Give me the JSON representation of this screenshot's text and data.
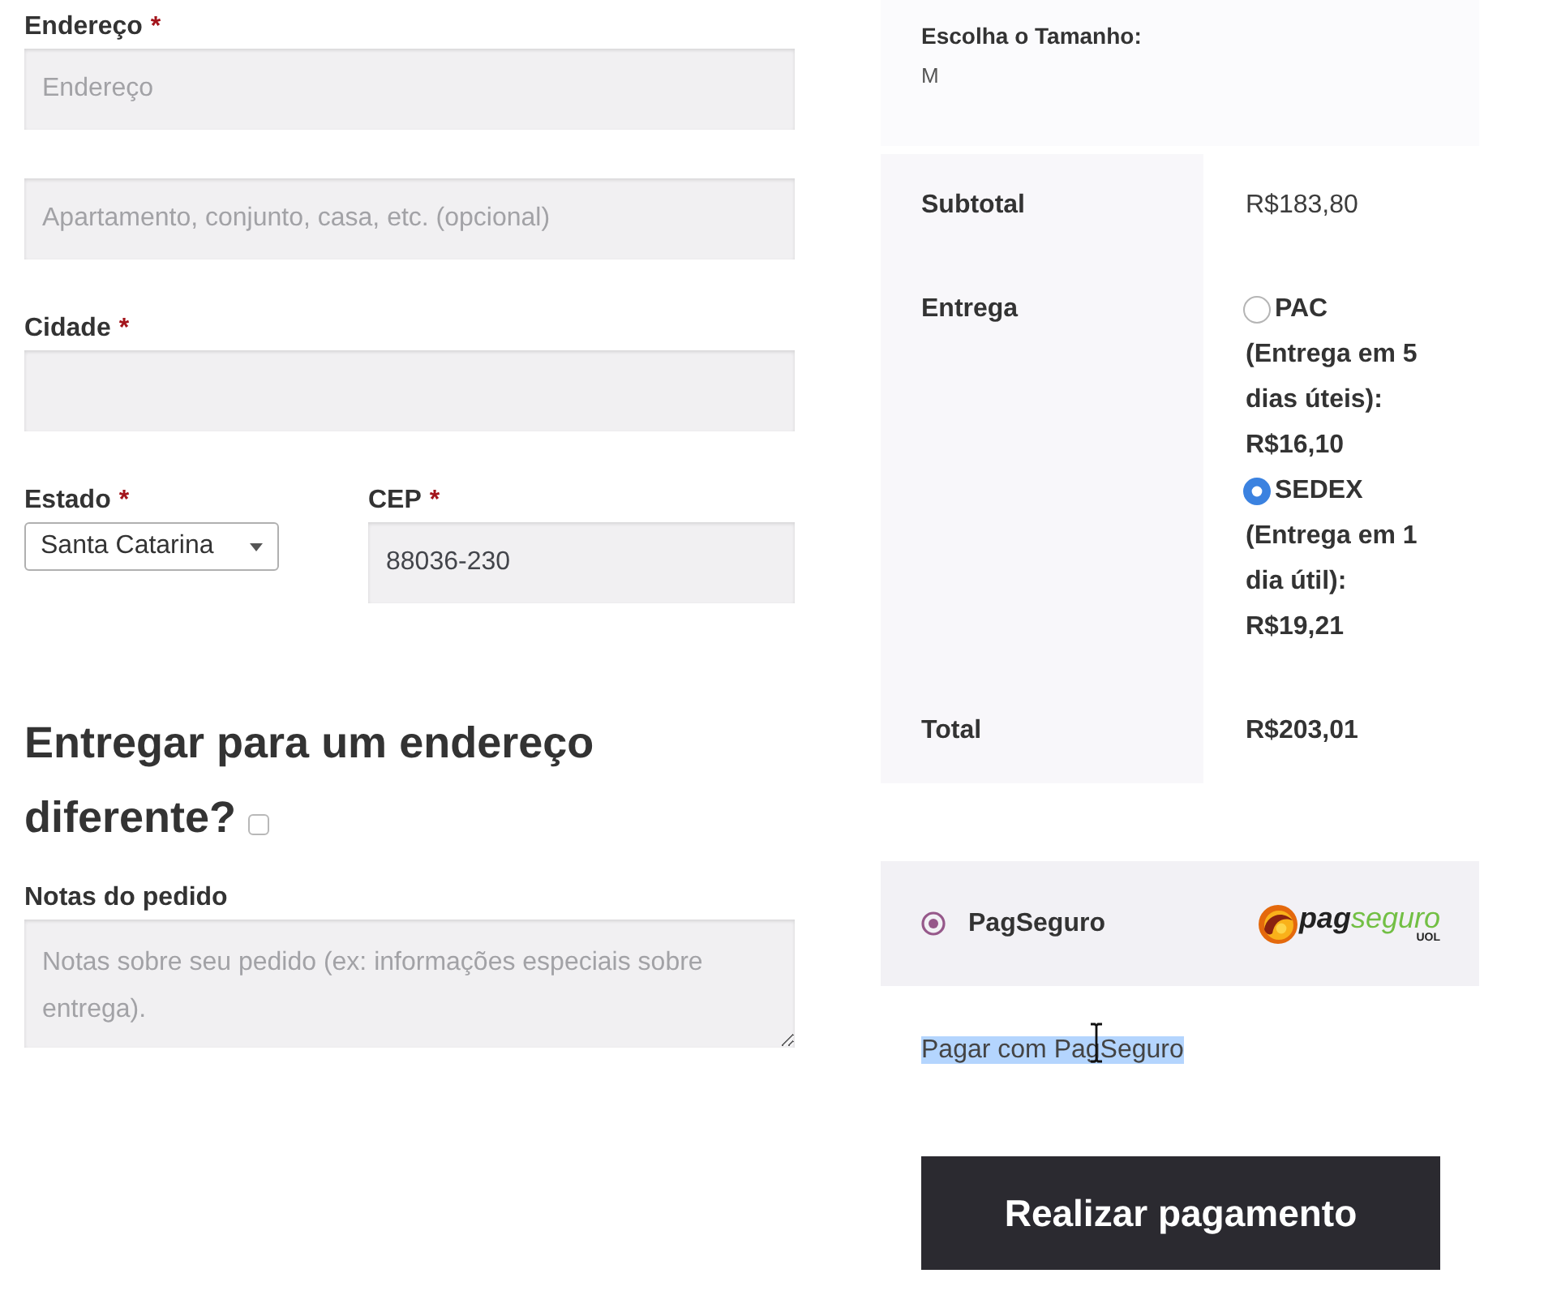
{
  "billing_fields": [
    {
      "kind": "text",
      "label": "Endereço",
      "required_mark": "*",
      "placeholder": "Endereço"
    },
    {
      "kind": "text",
      "placeholder": "Apartamento, conjunto, casa, etc. (opcional)"
    },
    {
      "kind": "text",
      "label": "Cidade",
      "required_mark": "*"
    },
    {
      "kind": "row",
      "fields": [
        {
          "kind": "select",
          "label": "Estado",
          "required_mark": "*",
          "value": "Santa Catarina"
        },
        {
          "kind": "text",
          "label": "CEP",
          "required_mark": "*",
          "value": "88036-230"
        }
      ]
    }
  ],
  "ship_to_different_address": {
    "heading": "Entregar para um endereço diferente?",
    "checked": false
  },
  "order_notes": {
    "kind": "textarea",
    "label": "Notas do pedido",
    "placeholder": "Notas sobre seu pedido (ex: informações especiais sobre entrega)."
  },
  "order_item": {
    "meta_label": "Escolha o Tamanho:",
    "meta_value": "M"
  },
  "totals": [
    {
      "kind": "amount",
      "label": "Subtotal",
      "value": "R$183,80"
    },
    {
      "kind": "shipping",
      "label": "Entrega",
      "options": [
        {
          "name": "PAC",
          "detail": "(Entrega em 5 dias úteis):",
          "price": "R$16,10",
          "selected": false
        },
        {
          "name": "SEDEX",
          "detail": "(Entrega em 1 dia útil):",
          "price": "R$19,21",
          "selected": true
        }
      ]
    },
    {
      "kind": "total",
      "label": "Total",
      "value": "R$203,01"
    }
  ],
  "payment": {
    "methods": [
      {
        "name": "PagSeguro",
        "selected": true,
        "logo": {
          "wordmark": [
            "pag",
            "seguro"
          ],
          "tagline": "UOL"
        }
      }
    ],
    "description": {
      "text": "Pagar com PagSeguro",
      "highlighted": true
    }
  },
  "place_order": {
    "label": "Realizar pagamento"
  }
}
